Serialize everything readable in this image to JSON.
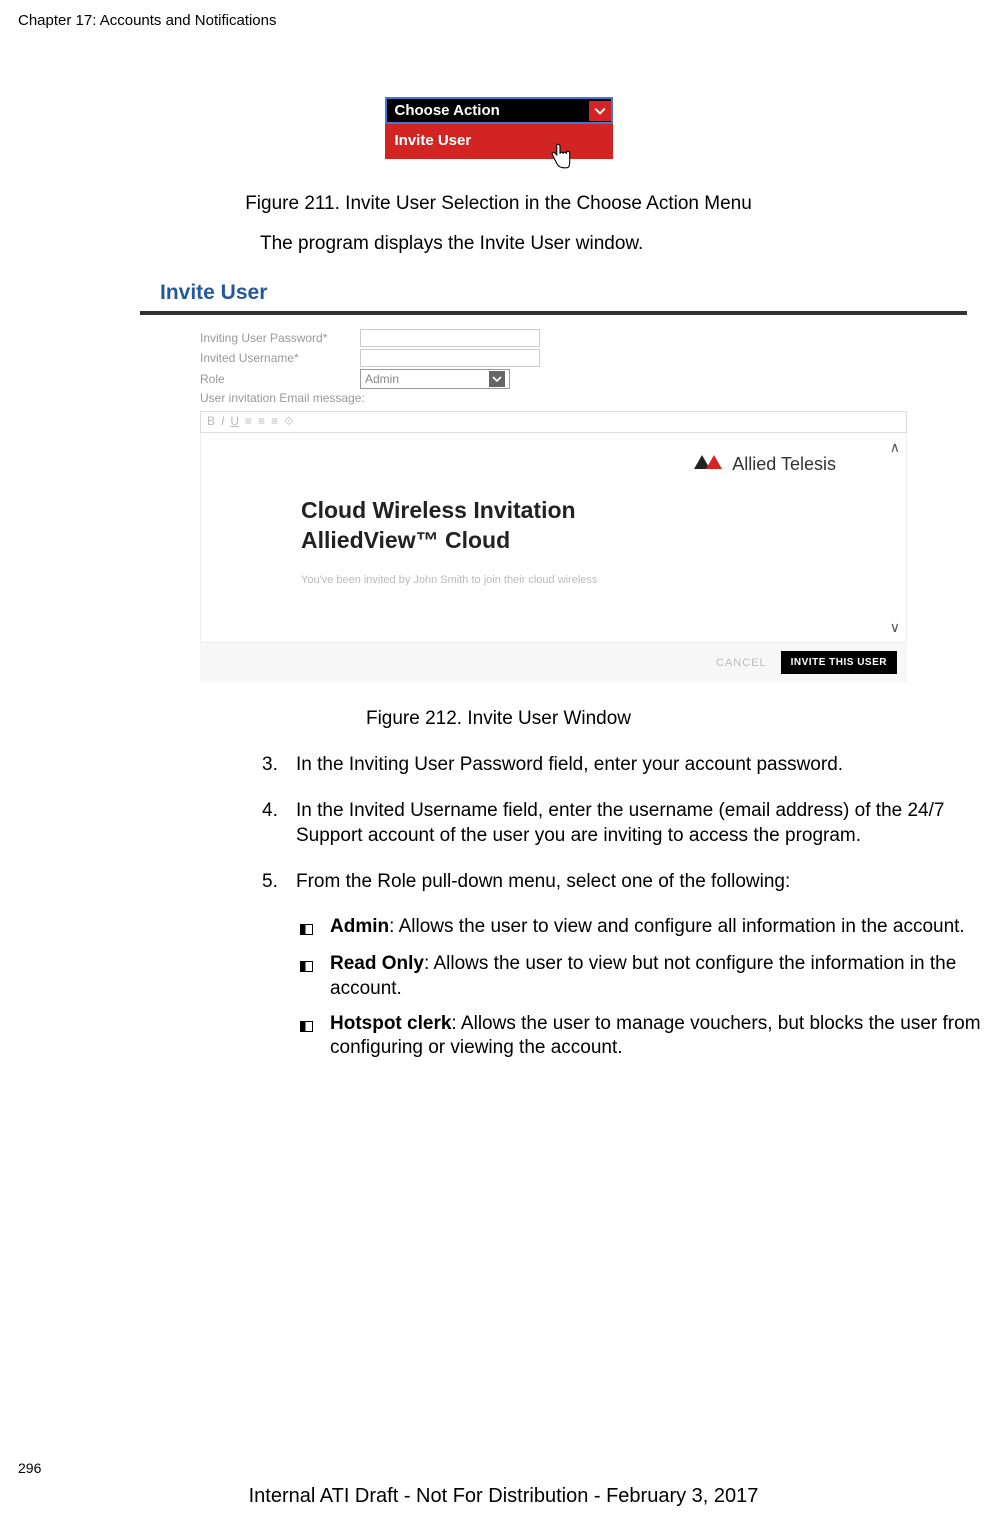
{
  "chapter_header": "Chapter 17: Accounts and Notifications",
  "dropdown": {
    "choose_label": "Choose Action",
    "item_label": "Invite User"
  },
  "fig211_caption": "Figure 211. Invite User Selection in the Choose Action Menu",
  "intro_line": "The program displays the Invite User window.",
  "invite_window": {
    "title": "Invite User",
    "labels": {
      "password": "Inviting User Password*",
      "username": "Invited Username*",
      "role": "Role",
      "email_msg": "User invitation Email message:"
    },
    "role_value": "Admin",
    "logo_text": "Allied Telesis",
    "rte_heading1": "Cloud Wireless Invitation",
    "rte_heading2": "AlliedView™ Cloud",
    "rte_smallline": "You've been invited by John Smith to join their cloud wireless",
    "btn_cancel": "CANCEL",
    "btn_invite": "INVITE THIS USER"
  },
  "fig212_caption": "Figure 212. Invite User Window",
  "steps": {
    "s3_num": "3.",
    "s3": "In the Inviting User Password field, enter your account password.",
    "s4_num": "4.",
    "s4": "In the Invited Username field, enter the username (email address) of the 24/7 Support account of the user you are inviting to access the program.",
    "s5_num": "5.",
    "s5": "From the Role pull-down menu, select one of the following:"
  },
  "roles": {
    "admin_label": "Admin",
    "admin_desc": ": Allows the user to view and configure all information in the account.",
    "readonly_label": "Read Only",
    "readonly_desc": ": Allows the user to view but not configure the information in the account.",
    "hotspot_label": "Hotspot clerk",
    "hotspot_desc": ": Allows the user to manage vouchers, but blocks the user from configuring or viewing the account."
  },
  "page_number": "296",
  "footer": "Internal ATI Draft - Not For Distribution - February 3, 2017"
}
